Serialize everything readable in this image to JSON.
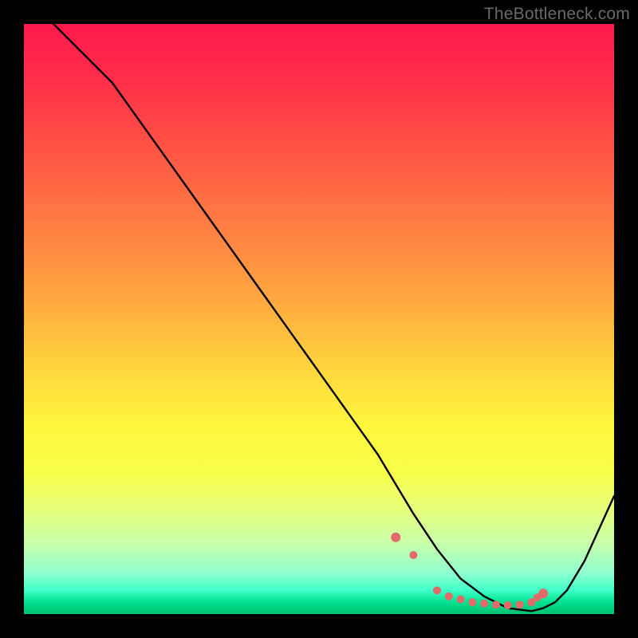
{
  "watermark": "TheBottleneck.com",
  "chart_data": {
    "type": "line",
    "title": "",
    "xlabel": "",
    "ylabel": "",
    "xlim": [
      0,
      100
    ],
    "ylim": [
      0,
      100
    ],
    "series": [
      {
        "name": "curve",
        "x": [
          5,
          10,
          15,
          20,
          25,
          30,
          35,
          40,
          45,
          50,
          55,
          60,
          63,
          66,
          70,
          74,
          78,
          82,
          86,
          88,
          90,
          92,
          95,
          100
        ],
        "values": [
          100,
          95,
          90,
          83,
          76,
          69,
          62,
          55,
          48,
          41,
          34,
          27,
          22,
          17,
          11,
          6,
          3,
          1,
          0.5,
          1,
          2,
          4,
          9,
          20
        ]
      }
    ],
    "markers": {
      "name": "valley-dots",
      "color": "#e26a6a",
      "x": [
        63,
        66,
        70,
        72,
        74,
        76,
        78,
        80,
        82,
        84,
        86,
        87,
        88
      ],
      "values": [
        13,
        10,
        4,
        3,
        2.5,
        2,
        1.8,
        1.6,
        1.5,
        1.6,
        2,
        2.8,
        3.5
      ]
    }
  }
}
